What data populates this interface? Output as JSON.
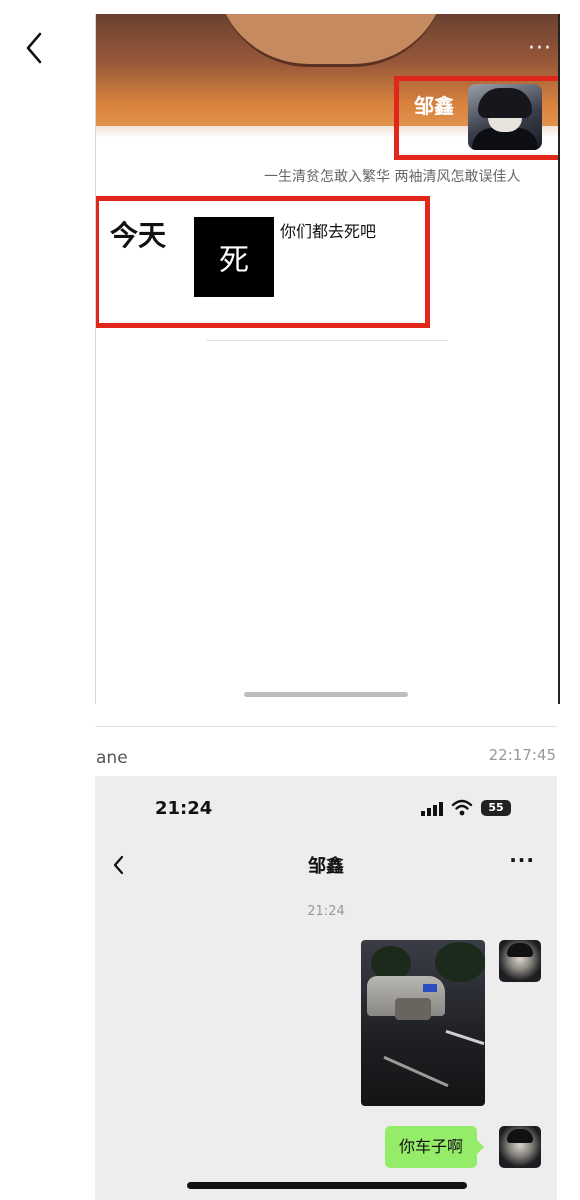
{
  "moments": {
    "profile_name": "邹鑫",
    "more": "···",
    "signature": "一生清贫怎敢入繁华 两袖清风怎敢误佳人",
    "post": {
      "date": "今天",
      "thumb_text": "死",
      "text": "你们都去死吧"
    }
  },
  "message": {
    "sender": "ane",
    "time": "22:17:45"
  },
  "chat": {
    "status_time": "21:24",
    "battery": "55",
    "title": "邹鑫",
    "more": "···",
    "timestamp": "21:24",
    "bubble_text": "你车子啊",
    "bubble_color": "#95ec69"
  },
  "colors": {
    "highlight": "#e1261c"
  }
}
